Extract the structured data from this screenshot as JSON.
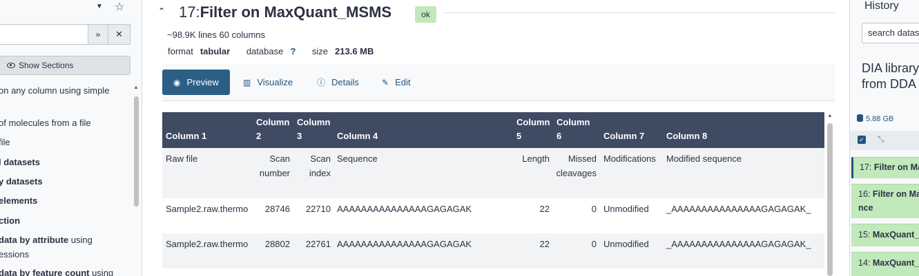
{
  "tool_panel": {
    "show_sections_label": "Show Sections",
    "advanced_icon": "double-chevron-down",
    "clear_icon": "x",
    "tools": [
      {
        "bold": "",
        "text": "on any column using simple"
      },
      {
        "bold": "",
        "text": "of molecules from a file"
      },
      {
        "bold": "",
        "text": " file"
      },
      {
        "bold": "l datasets",
        "text": ""
      },
      {
        "bold": "y datasets",
        "text": ""
      },
      {
        "bold": "elements",
        "text": ""
      },
      {
        "bold": "ction",
        "text": ""
      },
      {
        "bold": "data by attribute",
        "text": " using"
      },
      {
        "bold": "",
        "text": "essions"
      },
      {
        "bold": "data by feature count",
        "text": " using"
      }
    ]
  },
  "dataset": {
    "hid": "17:",
    "name": "Filter on MaxQuant_MSMS",
    "state": "ok",
    "summary": "~98.9K lines 60 columns",
    "format_label": "format",
    "format_value": "tabular",
    "database_label": "database",
    "database_value": "?",
    "size_label": "size",
    "size_value": "213.6 MB",
    "tabs": [
      {
        "label": "Preview",
        "icon": "eye-icon",
        "active": true
      },
      {
        "label": "Visualize",
        "icon": "chart-icon",
        "active": false
      },
      {
        "label": "Details",
        "icon": "info-icon",
        "active": false
      },
      {
        "label": "Edit",
        "icon": "pencil-icon",
        "active": false
      }
    ]
  },
  "table": {
    "headers": [
      "Column 1",
      "Column 2",
      "Column 3",
      "Column 4",
      "Column 5",
      "Column 6",
      "Column 7",
      "Column 8"
    ],
    "subheader": [
      "Raw file",
      "Scan number",
      "Scan index",
      "Sequence",
      "Length",
      "Missed cleavages",
      "Modifications",
      "Modified sequence"
    ],
    "rows": [
      [
        "Sample2.raw.thermo",
        "28746",
        "22710",
        "AAAAAAAAAAAAAAAGAGAGAK",
        "22",
        "0",
        "Unmodified",
        "_AAAAAAAAAAAAAAAGAGAGAK_"
      ],
      [
        "Sample2.raw.thermo",
        "28802",
        "22761",
        "AAAAAAAAAAAAAAAGAGAGAK",
        "22",
        "0",
        "Unmodified",
        "_AAAAAAAAAAAAAAAGAGAGAK_"
      ]
    ]
  },
  "history": {
    "title": "History",
    "search_placeholder": "search datasets",
    "name_line1": "DIA library",
    "name_line2": "from DDA",
    "size": "5.88 GB",
    "items": [
      {
        "hid": "17:",
        "name": "Filter on MaxQuant_MSMS",
        "line2": ""
      },
      {
        "hid": "16:",
        "name": "Filter on MaxQuant_MSMS",
        "line2": "nce"
      },
      {
        "hid": "15:",
        "name": "MaxQuant_",
        "line2": ""
      },
      {
        "hid": "14:",
        "name": "MaxQuant_",
        "line2": ""
      }
    ]
  },
  "colors": {
    "header_bg": "#3f4a63",
    "active_tab": "#2c5f86",
    "ok_state": "#c1e9bb",
    "link": "#25537b"
  }
}
